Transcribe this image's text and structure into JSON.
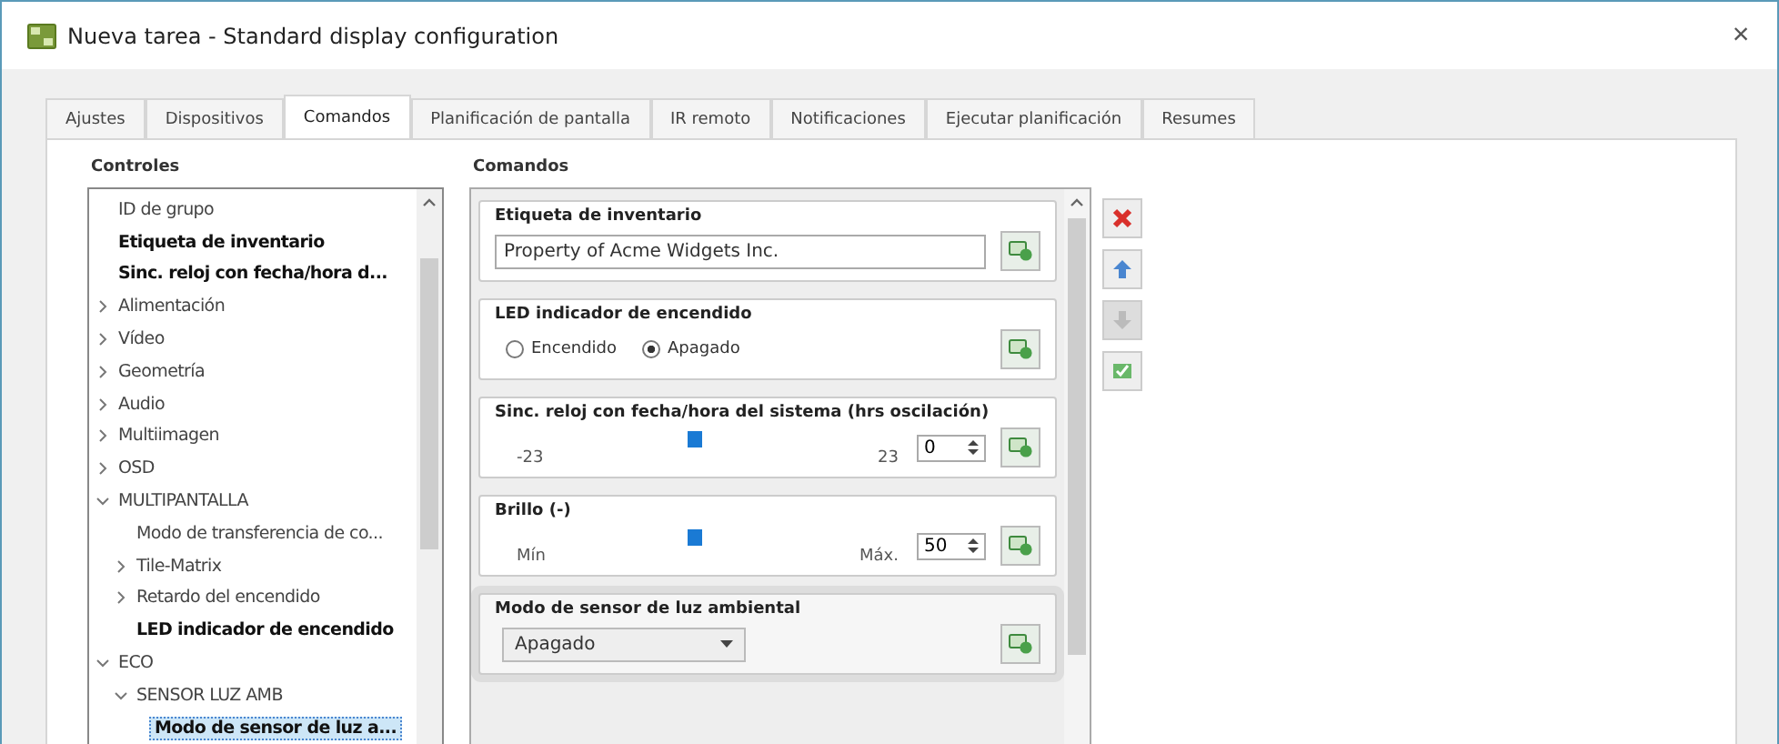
{
  "window": {
    "title": "Nueva tarea - Standard display configuration",
    "close": "×"
  },
  "tabs": [
    {
      "label": "Ajustes",
      "selected": false
    },
    {
      "label": "Dispositivos",
      "selected": false
    },
    {
      "label": "Comandos",
      "selected": true
    },
    {
      "label": "Planificación de pantalla",
      "selected": false
    },
    {
      "label": "IR remoto",
      "selected": false
    },
    {
      "label": "Notificaciones",
      "selected": false
    },
    {
      "label": "Ejecutar planificación",
      "selected": false
    },
    {
      "label": "Resumes",
      "selected": false
    }
  ],
  "controls": {
    "title": "Controles",
    "items": [
      {
        "label": "ID de grupo",
        "bold": false,
        "selected": false
      },
      {
        "label": "Etiqueta de inventario",
        "bold": true,
        "selected": false
      },
      {
        "label": "Sinc. reloj con fecha/hora d...",
        "bold": true,
        "selected": false
      },
      {
        "label": "Alimentación",
        "bold": false,
        "selected": false,
        "expanded": false
      },
      {
        "label": "Vídeo",
        "bold": false,
        "selected": false,
        "expanded": false
      },
      {
        "label": "Geometría",
        "bold": false,
        "selected": false,
        "expanded": false
      },
      {
        "label": "Audio",
        "bold": false,
        "selected": false,
        "expanded": false
      },
      {
        "label": "Multiimagen",
        "bold": false,
        "selected": false,
        "expanded": false
      },
      {
        "label": "OSD",
        "bold": false,
        "selected": false,
        "expanded": false
      },
      {
        "label": "MULTIPANTALLA",
        "bold": false,
        "selected": false,
        "expanded": true,
        "children": [
          {
            "label": "Modo de transferencia de co...",
            "bold": false,
            "selected": false
          },
          {
            "label": "Tile-Matrix",
            "bold": false,
            "selected": false,
            "expanded": false
          },
          {
            "label": "Retardo del encendido",
            "bold": false,
            "selected": false,
            "expanded": false
          },
          {
            "label": "LED indicador de encendido",
            "bold": true,
            "selected": false
          }
        ]
      },
      {
        "label": "ECO",
        "bold": false,
        "selected": false,
        "expanded": true,
        "children": [
          {
            "label": "SENSOR LUZ AMB",
            "bold": false,
            "selected": false,
            "expanded": true,
            "children": [
              {
                "label": "Modo de sensor de luz a...",
                "bold": true,
                "selected": true
              }
            ]
          }
        ]
      }
    ]
  },
  "commands": {
    "title": "Comandos",
    "panels": [
      {
        "kind": "text",
        "title": "Etiqueta de inventario",
        "value": "Property of Acme Widgets Inc.",
        "selected": false
      },
      {
        "kind": "radio",
        "title": "LED indicador de encendido",
        "options": [
          {
            "label": "Encendido",
            "selected": false
          },
          {
            "label": "Apagado",
            "selected": true
          }
        ],
        "selected": false
      },
      {
        "kind": "slider",
        "title": "Sinc. reloj con fecha/hora del sistema (hrs oscilación)",
        "min": "-23",
        "max": "23",
        "level": 0.5,
        "value": "0",
        "selected": false
      },
      {
        "kind": "slider",
        "title": "Brillo (-)",
        "min": "Mín",
        "max": "Máx.",
        "level": 0.5,
        "value": "50",
        "selected": false
      },
      {
        "kind": "select",
        "title": "Modo de sensor de luz ambiental",
        "value": "Apagado",
        "selected": true
      }
    ]
  },
  "side_buttons": [
    {
      "kind": "delete",
      "disabled": false
    },
    {
      "kind": "up",
      "disabled": false
    },
    {
      "kind": "down",
      "disabled": true
    },
    {
      "kind": "apply",
      "disabled": false
    }
  ]
}
